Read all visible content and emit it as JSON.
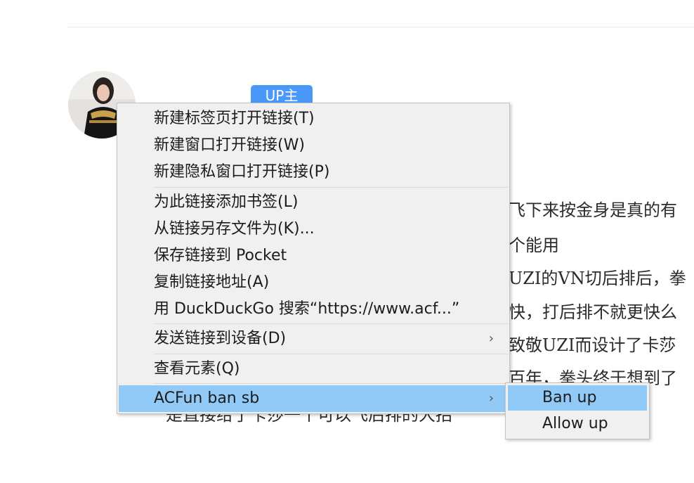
{
  "page": {
    "up_badge": "UP主",
    "comment_lines": [
      "飞下来按金身是真的有",
      "个能用",
      "UZI的VN切后排后，拳",
      "快，打后排不就更快么",
      "致敬UZI而设计了卡莎",
      "百年，拳头终于想到了",
      "是直接给了卡莎一个可以飞后排的大招"
    ]
  },
  "context_menu": {
    "items": [
      {
        "label": "新建标签页打开链接(T)"
      },
      {
        "label": "新建窗口打开链接(W)"
      },
      {
        "label": "新建隐私窗口打开链接(P)"
      },
      {
        "label": "为此链接添加书签(L)"
      },
      {
        "label": "从链接另存文件为(K)..."
      },
      {
        "label": "保存链接到 Pocket"
      },
      {
        "label": "复制链接地址(A)"
      },
      {
        "label": "用 DuckDuckGo 搜索“https://www.acf...”"
      },
      {
        "label": "发送链接到设备(D)",
        "submenu_arrow": "›"
      },
      {
        "label": "查看元素(Q)"
      },
      {
        "label": "ACFun ban sb",
        "submenu_arrow": "›"
      }
    ]
  },
  "submenu": {
    "items": [
      {
        "label": "Ban up"
      },
      {
        "label": "Allow up"
      }
    ]
  },
  "colors": {
    "menu_bg": "#f0f0f0",
    "highlight": "#91c9f7",
    "badge_blue": "#4a98f7"
  },
  "icons": [
    "avatar-image",
    "chevron-right-icon"
  ]
}
